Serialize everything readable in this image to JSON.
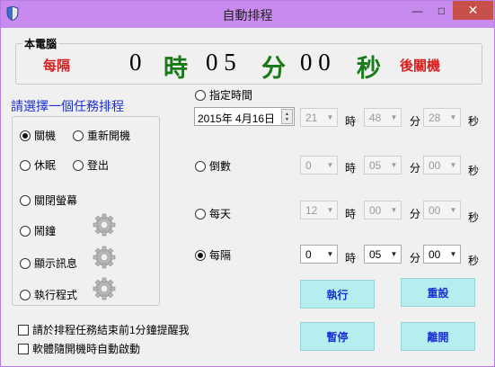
{
  "window": {
    "title": "自動排程",
    "minimize": "—",
    "maximize": "□",
    "close": "✕"
  },
  "countdown": {
    "group_label": "本電腦",
    "prefix": "每隔",
    "hours": "0",
    "hours_unit": "時",
    "minutes": "0 5",
    "minutes_unit": "分",
    "seconds": "0 0",
    "seconds_unit": "秒",
    "suffix": "後關機"
  },
  "tasks": {
    "title": "請選擇一個任務排程",
    "options": [
      {
        "label": "關機",
        "selected": true
      },
      {
        "label": "重新開機",
        "selected": false
      },
      {
        "label": "休眠",
        "selected": false
      },
      {
        "label": "登出",
        "selected": false
      },
      {
        "label": "關閉螢幕",
        "selected": false
      },
      {
        "label": "鬧鐘",
        "selected": false
      },
      {
        "label": "顯示訊息",
        "selected": false
      },
      {
        "label": "執行程式",
        "selected": false
      }
    ]
  },
  "schedule": {
    "specific_time": {
      "label": "指定時間",
      "date": "2015年  4月16日",
      "hour": "21",
      "minute": "48",
      "second": "28"
    },
    "countdown": {
      "label": "倒數",
      "hour": "0",
      "minute": "05",
      "second": "00"
    },
    "daily": {
      "label": "每天",
      "hour": "12",
      "minute": "00",
      "second": "00"
    },
    "interval": {
      "label": "每隔",
      "hour": "0",
      "minute": "05",
      "second": "00",
      "selected": true
    },
    "unit_hour": "時",
    "unit_minute": "分",
    "unit_second": "秒"
  },
  "options": {
    "remind": "請於排程任務結束前1分鐘提醒我",
    "autostart": "軟體隨開機時自動啟動"
  },
  "buttons": {
    "run": "執行",
    "reset": "重設",
    "pause": "暫停",
    "exit": "離開"
  }
}
